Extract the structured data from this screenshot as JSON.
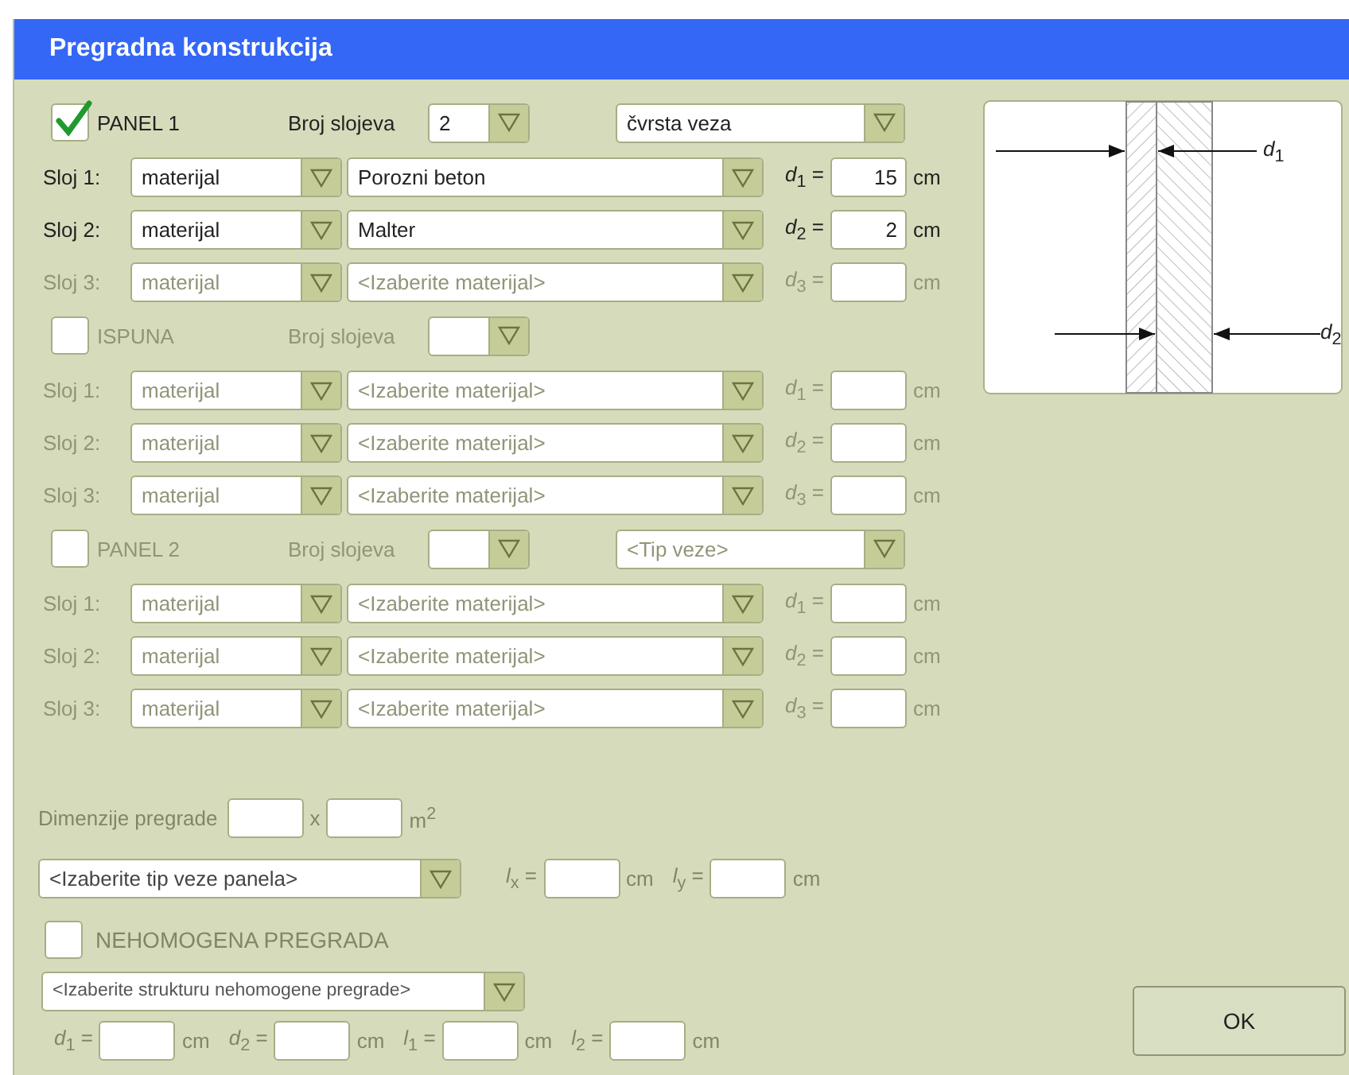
{
  "window": {
    "title": "Pregradna konstrukcija"
  },
  "sections": [
    {
      "label": "PANEL 1",
      "checked": true,
      "disabled": false,
      "count_label": "Broj slojeva",
      "count": "2",
      "connection": "čvrsta veza",
      "layers": [
        {
          "label": "Sloj 1:",
          "type": "materijal",
          "material": "Porozni beton",
          "d_label": "*d*$_{1}$ =",
          "d": "15",
          "unit": "cm",
          "disabled": false
        },
        {
          "label": "Sloj 2:",
          "type": "materijal",
          "material": "Malter",
          "d_label": "*d*$_{2}$ =",
          "d": "2",
          "unit": "cm",
          "disabled": false
        },
        {
          "label": "Sloj 3:",
          "type": "materijal",
          "material": "<Izaberite materijal>",
          "d_label": "*d*$_{3}$ =",
          "unit": "cm",
          "disabled": true
        }
      ]
    },
    {
      "label": "ISPUNA",
      "checked": false,
      "disabled": true,
      "count_label": "Broj slojeva",
      "layers": [
        {
          "label": "Sloj 1:",
          "type": "materijal",
          "material": "<Izaberite materijal>",
          "d_label": "*d*$_{1}$ =",
          "unit": "cm",
          "disabled": true
        },
        {
          "label": "Sloj 2:",
          "type": "materijal",
          "material": "<Izaberite materijal>",
          "d_label": "*d*$_{2}$ =",
          "unit": "cm",
          "disabled": true
        },
        {
          "label": "Sloj 3:",
          "type": "materijal",
          "material": "<Izaberite materijal>",
          "d_label": "*d*$_{3}$ =",
          "unit": "cm",
          "disabled": true
        }
      ]
    },
    {
      "label": "PANEL 2",
      "checked": false,
      "disabled": true,
      "count_label": "Broj slojeva",
      "connection": "<Tip veze>",
      "layers": [
        {
          "label": "Sloj 1:",
          "type": "materijal",
          "material": "<Izaberite materijal>",
          "d_label": "*d*$_{1}$ =",
          "unit": "cm",
          "disabled": true
        },
        {
          "label": "Sloj 2:",
          "type": "materijal",
          "material": "<Izaberite materijal>",
          "d_label": "*d*$_{2}$ =",
          "unit": "cm",
          "disabled": true
        },
        {
          "label": "Sloj 3:",
          "type": "materijal",
          "material": "<Izaberite materijal>",
          "d_label": "*d*$_{3}$ =",
          "unit": "cm",
          "disabled": true
        }
      ]
    }
  ],
  "dimensions": {
    "label": "Dimenzije pregrade",
    "times": "x",
    "unit": "m$^{2}$"
  },
  "panel_connection": {
    "select": "<Izaberite tip veze panela>",
    "fields": [
      {
        "label": "*l*$_{x}$ =",
        "unit": "cm"
      },
      {
        "label": "*l*$_{y}$ =",
        "unit": "cm"
      }
    ]
  },
  "nonhomogeneous": {
    "label": "NEHOMOGENA PREGRADA",
    "checked": false,
    "select": "<Izaberite strukturu nehomogene pregrade>",
    "fields": [
      {
        "label": "*d*$_{1}$ =",
        "unit": "cm"
      },
      {
        "label": "*d*$_{2}$ =",
        "unit": "cm"
      },
      {
        "label": "*l*$_{1}$ =",
        "unit": "cm"
      },
      {
        "label": "*l*$_{2}$ =",
        "unit": "cm"
      }
    ]
  },
  "diagram": {
    "labels": [
      "*d*$_{1}$",
      "*d*$_{2}$"
    ]
  },
  "ok_button": "OK"
}
